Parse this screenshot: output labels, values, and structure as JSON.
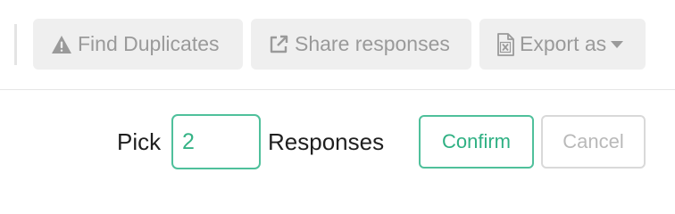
{
  "toolbar": {
    "find_duplicates": {
      "label": "Find Duplicates",
      "icon": "warning-triangle-icon"
    },
    "share_responses": {
      "label": "Share responses",
      "icon": "external-link-icon"
    },
    "export_as": {
      "label": "Export as",
      "icon": "excel-file-icon",
      "dropdown_icon": "caret-down-icon"
    }
  },
  "pick": {
    "label": "Pick",
    "value": "2",
    "suffix": "Responses"
  },
  "actions": {
    "confirm_label": "Confirm",
    "cancel_label": "Cancel"
  },
  "colors": {
    "accent": "#4fc09b",
    "toolbar_button_bg": "#efefef",
    "toolbar_text": "#9a9a9a",
    "disabled": "#b9b9b9"
  }
}
